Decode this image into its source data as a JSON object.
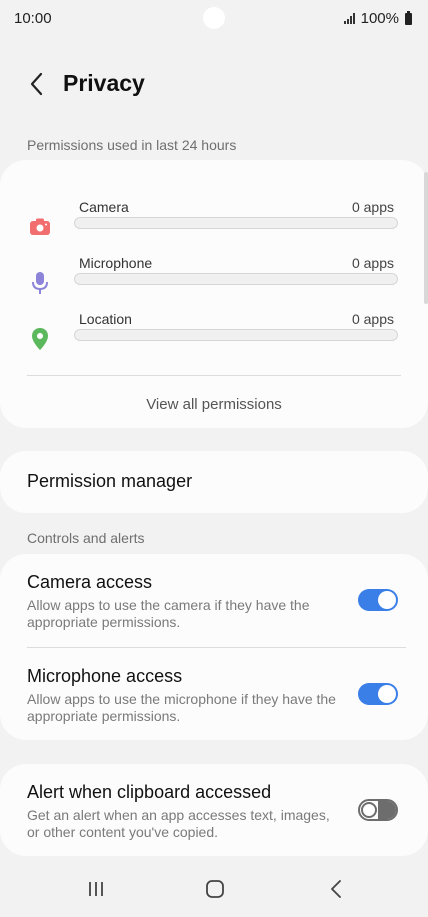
{
  "status": {
    "time": "10:00",
    "battery": "100%"
  },
  "header": {
    "title": "Privacy"
  },
  "permissions_section": {
    "label": "Permissions used in last 24 hours",
    "items": [
      {
        "name": "Camera",
        "count": "0 apps",
        "usage_fraction": 0,
        "icon": "camera-icon",
        "color": "#f26d6d"
      },
      {
        "name": "Microphone",
        "count": "0 apps",
        "usage_fraction": 0,
        "icon": "microphone-icon",
        "color": "#8c84d8"
      },
      {
        "name": "Location",
        "count": "0 apps",
        "usage_fraction": 0,
        "icon": "location-pin-icon",
        "color": "#5cb85c"
      }
    ],
    "view_all": "View all permissions"
  },
  "permission_manager": {
    "label": "Permission manager"
  },
  "controls_section": {
    "label": "Controls and alerts",
    "camera_access": {
      "title": "Camera access",
      "description": "Allow apps to use the camera if they have the appropriate permissions.",
      "enabled": true
    },
    "microphone_access": {
      "title": "Microphone access",
      "description": "Allow apps to use the microphone if they have the appropriate permissions.",
      "enabled": true
    }
  },
  "clipboard_alert": {
    "title": "Alert when clipboard accessed",
    "description": "Get an alert when an app accesses text, images, or other content you've copied.",
    "enabled": false
  },
  "colors": {
    "accent": "#3a7ee8",
    "background": "#f2f2f2",
    "card": "#fcfcfc"
  }
}
